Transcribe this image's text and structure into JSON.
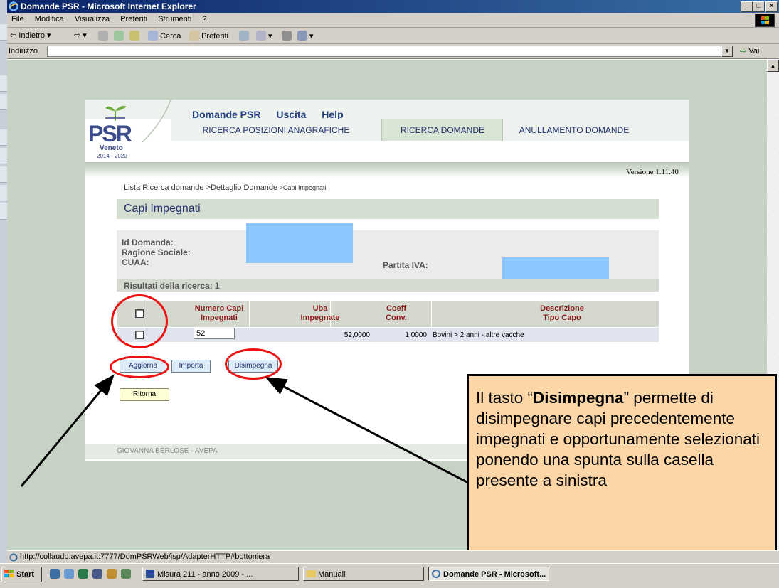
{
  "window": {
    "title": "Domande PSR - Microsoft Internet Explorer",
    "controls": {
      "minimize": "_",
      "maximize": "□",
      "close": "×"
    }
  },
  "menu": [
    "File",
    "Modifica",
    "Visualizza",
    "Preferiti",
    "Strumenti",
    "?"
  ],
  "toolbar": {
    "back": "⇦ Indietro ▾",
    "forward": "⇨ ▾",
    "search": "Cerca",
    "favorites": "Preferiti"
  },
  "address": {
    "label": "Indirizzo",
    "value": "",
    "go": "Vai"
  },
  "app": {
    "logo": {
      "text": "PSR",
      "region": "Veneto",
      "years": "2014 - 2020"
    },
    "topnav": [
      "Domande PSR",
      "Uscita",
      "Help"
    ],
    "tabs": [
      "RICERCA POSIZIONI ANAGRAFICHE",
      "RICERCA DOMANDE",
      "ANULLAMENTO DOMANDE"
    ],
    "version": "Versione 1.11.40",
    "breadcrumb": {
      "part1": "Lista Ricerca domande",
      "part2": " >Dettaglio Domande",
      "part3": " >Capi Impegnati"
    },
    "page_title": "Capi Impegnati",
    "labels": {
      "id_domanda": "Id Domanda:",
      "ragione_sociale": "Ragione Sociale:",
      "cuaa": "CUAA:",
      "partita_iva": "Partita IVA:"
    },
    "results": "Risultati della ricerca:   1",
    "table": {
      "headers": {
        "numero_capi": "Numero Capi",
        "numero_capi_2": "Impegnati",
        "uba": "Uba",
        "uba_2": "Impegnate",
        "coeff": "Coeff",
        "coeff_2": "Conv.",
        "descrizione": "Descrizione",
        "descrizione_2": "Tipo Capo"
      },
      "row": {
        "numero_capi": "52",
        "uba": "52,0000",
        "coeff": "1,0000",
        "descrizione": "Bovini > 2 anni - altre vacche"
      }
    },
    "buttons": {
      "aggiorna": "Aggiorna",
      "importa": "Importa",
      "disimpegna": "Disimpegna",
      "ritorna": "Ritorna"
    },
    "footer": "GIOVANNA BERLOSE - AVEPA"
  },
  "callout": {
    "pre": "Il tasto “",
    "bold": "Disimpegna",
    "post": "” permette di disimpegnare capi precedentemente impegnati e opportunamente selezionati ponendo una spunta sulla casella presente a sinistra"
  },
  "status_url": "http://collaudo.avepa.it:7777/DomPSRWeb/jsp/AdapterHTTP#bottoniera",
  "taskbar": {
    "start": "Start",
    "tasks": [
      "Misura 211 - anno 2009 - ...",
      "Manuali",
      "Domande PSR - Microsoft..."
    ]
  },
  "colors": {
    "annotation": "#ee1111",
    "callout_bg": "#fcd6a6",
    "page_bg": "#c6d2c4"
  }
}
